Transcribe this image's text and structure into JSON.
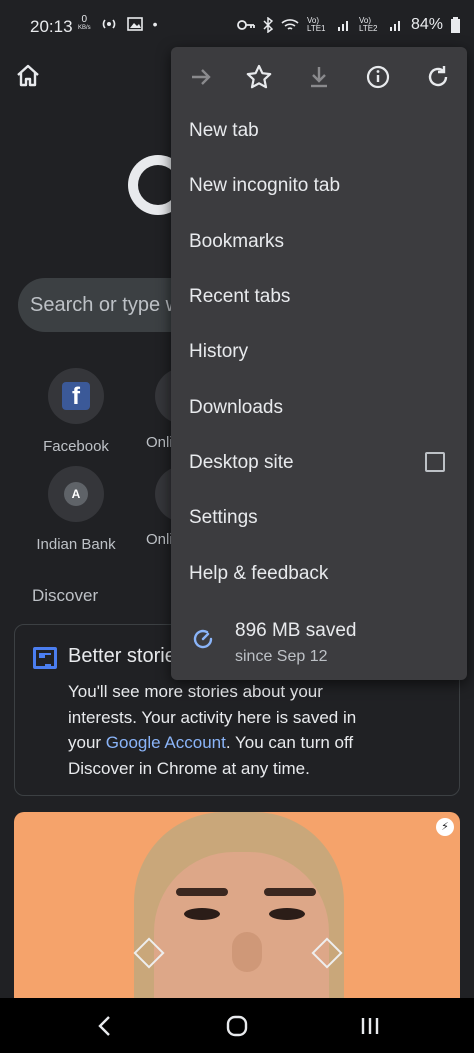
{
  "status_bar": {
    "time": "20:13",
    "net_speed": "0",
    "net_unit": "KB/s",
    "lte1": "Vo) LTE1",
    "lte2": "Vo) LTE2",
    "battery": "84%"
  },
  "page": {
    "search_placeholder": "Search or type w",
    "tiles": [
      {
        "label": "Facebook",
        "icon": "facebook-icon"
      },
      {
        "label": "Indian Bank",
        "icon": "letter-a-icon",
        "letter": "A"
      }
    ],
    "partial_tiles": [
      "Onli",
      "Onli"
    ],
    "discover_label": "Discover",
    "card": {
      "title": "Better storie",
      "body_before": "You'll see more stories about your interests. Your activity here is saved in your ",
      "link": "Google Account",
      "body_after": ". You can turn off Discover in Chrome at any time."
    }
  },
  "menu": {
    "toolbar_icons": [
      "forward-arrow-icon",
      "star-icon",
      "download-icon",
      "info-icon",
      "refresh-icon"
    ],
    "items": [
      "New tab",
      "New incognito tab",
      "Bookmarks",
      "Recent tabs",
      "History",
      "Downloads",
      "Desktop site",
      "Settings",
      "Help & feedback"
    ],
    "desktop_site_checked": false,
    "data_saved": "896 MB saved",
    "data_saved_since": "since Sep 12"
  },
  "nav": {
    "icons": [
      "back-icon",
      "home-icon",
      "recents-icon"
    ]
  },
  "colors": {
    "background": "#202124",
    "menu": "#3c3c3f",
    "link": "#8ab4f8",
    "accent": "#8ab4f8"
  }
}
